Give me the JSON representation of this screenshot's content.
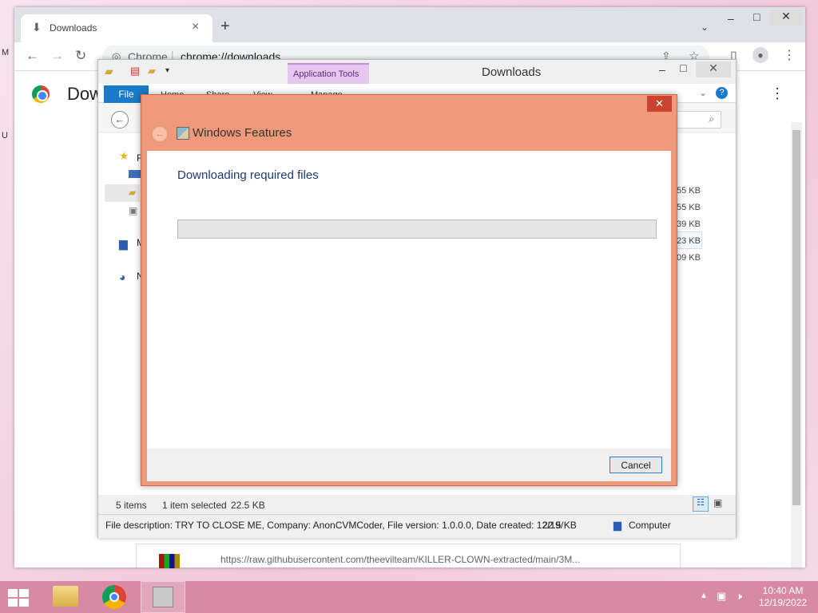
{
  "desktop": {
    "side_labels": [
      "M",
      "U"
    ]
  },
  "chrome": {
    "tab": {
      "title": "Downloads",
      "close": "×"
    },
    "new_tab": "+",
    "tab_search": "⌄",
    "window_controls": {
      "minimize": "–",
      "maximize": "□",
      "close": "✕"
    },
    "toolbar": {
      "back": "←",
      "forward": "→",
      "reload": "↻",
      "site_label": "Chrome",
      "url": "chrome://downloads"
    },
    "page": {
      "heading": "Dow",
      "download_url": "https://raw.githubusercontent.com/theevilteam/KILLER-CLOWN-extracted/main/3M..."
    }
  },
  "explorer": {
    "title": "Downloads",
    "contextual_tab": "Application Tools",
    "ribbon": {
      "file": "File",
      "home": "Home",
      "share": "Share",
      "view": "View",
      "manage": "Manage"
    },
    "nav_items": [
      {
        "label": "F"
      },
      {
        "label": ""
      },
      {
        "label": ""
      },
      {
        "label": ""
      },
      {
        "label": "M"
      },
      {
        "label": "N"
      }
    ],
    "file_sizes": [
      "55 KB",
      "55 KB",
      "39 KB",
      "23 KB",
      "09 KB"
    ],
    "status": {
      "items": "5 items",
      "selected": "1 item selected",
      "size": "22.5 KB"
    },
    "details": {
      "description": "File description: TRY TO CLOSE ME, Company: AnonCVMCoder, File version: 1.0.0.0, Date created: 12/19/",
      "size": "22.5 KB",
      "location": "Computer"
    }
  },
  "features": {
    "title": "Windows Features",
    "close": "✕",
    "heading": "Downloading required files",
    "progress": 0,
    "cancel": "Cancel"
  },
  "taskbar": {
    "time": "10:40 AM",
    "date": "12/19/2022"
  }
}
